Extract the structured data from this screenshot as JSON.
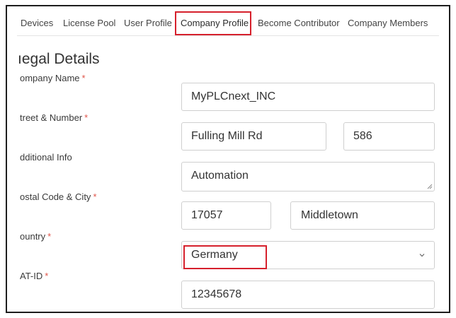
{
  "tabs": [
    {
      "label": "Devices"
    },
    {
      "label": "License Pool"
    },
    {
      "label": "User Profile"
    },
    {
      "label": "Company Profile"
    },
    {
      "label": "Become Contributor"
    },
    {
      "label": "Company Members"
    }
  ],
  "section_title": "ıegal Details",
  "form": {
    "company_name": {
      "label": "ompany Name",
      "required_mark": "*",
      "value": "MyPLCnext_INC"
    },
    "street": {
      "label": "treet & Number",
      "required_mark": "*",
      "value": "Fulling Mill Rd",
      "number_value": "586"
    },
    "additional_info": {
      "label": "dditional Info",
      "value": "Automation"
    },
    "postal_city": {
      "label": "ostal Code & City",
      "required_mark": "*",
      "postal_value": "17057",
      "city_value": "Middletown"
    },
    "country": {
      "label": "ountry",
      "required_mark": "*",
      "value": "Germany"
    },
    "vat_id": {
      "label": "AT-ID",
      "required_mark": "*",
      "value": "12345678"
    }
  },
  "colors": {
    "highlight": "#d6202c",
    "required": "#e0554a",
    "border": "#cfcfcf"
  }
}
